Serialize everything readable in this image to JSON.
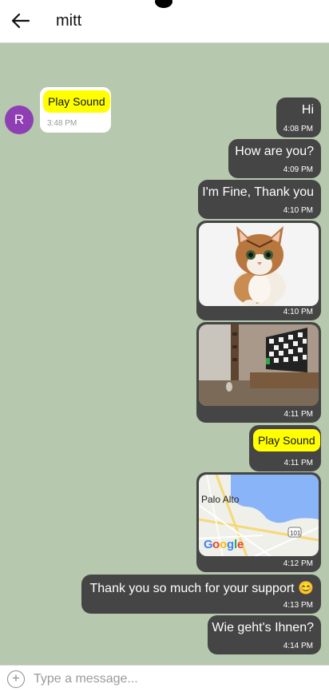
{
  "header": {
    "title": "mitt",
    "back_icon": "arrow-left-icon"
  },
  "incoming": {
    "avatar_letter": "R",
    "avatar_color": "#8e3fb4",
    "play_label": "Play Sound",
    "time": "3:48 PM"
  },
  "messages": [
    {
      "text": "Hi",
      "time": "4:08 PM"
    },
    {
      "text": "How are you?",
      "time": "4:09 PM"
    },
    {
      "text": "I'm Fine, Thank you",
      "time": "4:10 PM"
    },
    {
      "image": "cat-photo",
      "time": "4:10 PM"
    },
    {
      "image": "room-tv-photo",
      "time": "4:11 PM"
    },
    {
      "play_label": "Play Sound",
      "time": "4:11 PM"
    },
    {
      "image": "map",
      "map_label": "Palo Alto",
      "time": "4:12 PM"
    },
    {
      "text": "Thank you so much for your support 😊",
      "time": "4:13 PM"
    },
    {
      "text": "Wie geht's Ihnen?",
      "time": "4:14 PM"
    }
  ],
  "composer": {
    "placeholder": "Type a message...",
    "add_icon": "plus-circle-icon"
  },
  "colors": {
    "chat_background": "#b6c8ad",
    "outgoing_bubble": "#454545",
    "play_button": "#ffff00"
  }
}
